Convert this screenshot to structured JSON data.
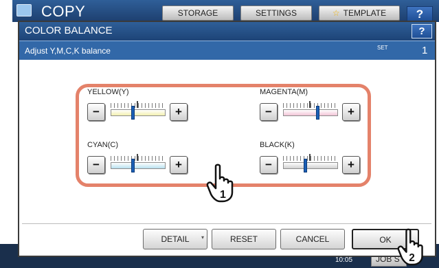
{
  "background": {
    "app_title": "COPY",
    "tabs": [
      "STORAGE",
      "SETTINGS",
      "TEMPLATE"
    ],
    "help": "?",
    "clock": "10:05",
    "job_button": "JOB S"
  },
  "dialog": {
    "title": "COLOR BALANCE",
    "help": "?",
    "message": "Adjust Y,M,C,K balance",
    "set_label": "SET",
    "set_number": "1"
  },
  "controls": [
    {
      "label": "YELLOW(Y)",
      "color": "#f3f0b0",
      "level": 0.4
    },
    {
      "label": "MAGENTA(M)",
      "color": "#f2c4d6",
      "level": 0.63
    },
    {
      "label": "CYAN(C)",
      "color": "#b8e0ef",
      "level": 0.4
    },
    {
      "label": "BLACK(K)",
      "color": "#d0d0d0",
      "level": 0.4
    }
  ],
  "plus_symbol": "+",
  "minus_symbol": "−",
  "buttons": {
    "detail": "DETAIL",
    "reset": "RESET",
    "cancel": "CANCEL",
    "ok": "OK"
  },
  "callouts": [
    "1",
    "2"
  ],
  "colors": {
    "accent_blue": "#2f5f98",
    "highlight_ring": "#e4826a",
    "slider_thumb": "#1b5fb5"
  }
}
